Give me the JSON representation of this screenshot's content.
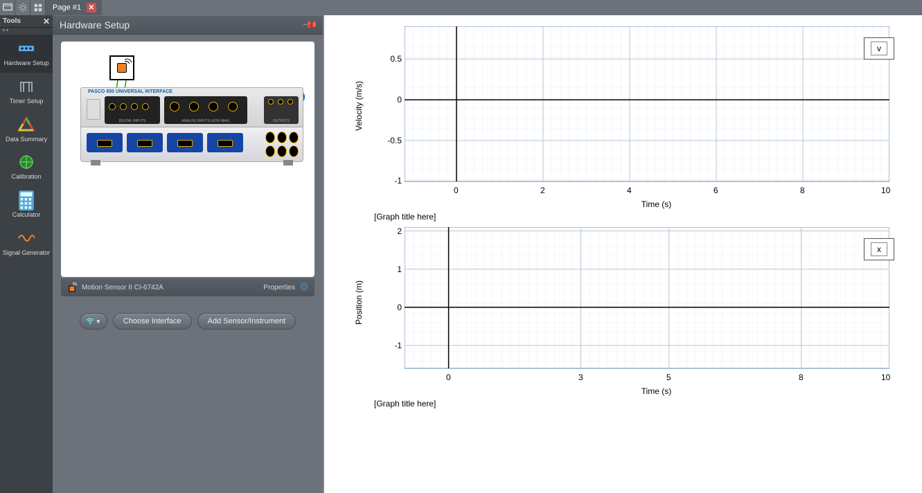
{
  "topbar": {
    "tab_label": "Page #1"
  },
  "tools_panel": {
    "header": "Tools",
    "items": [
      {
        "label": "Hardware Setup"
      },
      {
        "label": "Timer Setup"
      },
      {
        "label": "Data Summary"
      },
      {
        "label": "Calibration"
      },
      {
        "label": "Calculator"
      },
      {
        "label": "Signal Generator"
      }
    ]
  },
  "hardware_panel": {
    "title": "Hardware Setup",
    "device_title": "850 UNIVERSAL INTERFACE",
    "digital_label": "DIGITAL INPUTS",
    "analog_label": "ANALOG INPUTS (±20V MAX)",
    "output_label": "OUTPUTS",
    "sensor_name": "Motion Sensor II CI-6742A",
    "properties_label": "Properties",
    "choose_interface_label": "Choose Interface",
    "add_sensor_label": "Add Sensor/Instrument"
  },
  "chart_data": [
    {
      "type": "line",
      "ylabel": "Velocity (m/s)",
      "xlabel": "Time (s)",
      "title": "[Graph title here]",
      "legend": "v",
      "y_ticks": [
        -1.0,
        -0.5,
        0.0,
        0.5
      ],
      "x_ticks": [
        0,
        2,
        4,
        6,
        8,
        10
      ],
      "ylim": [
        -1.0,
        0.9
      ],
      "xlim": [
        -1.2,
        10
      ],
      "series": [
        {
          "name": "v",
          "values": []
        }
      ]
    },
    {
      "type": "line",
      "ylabel": "Position (m)",
      "xlabel": "Time (s)",
      "title": "[Graph title here]",
      "legend": "x",
      "y_ticks": [
        -1,
        0,
        1,
        2
      ],
      "x_ticks": [
        0,
        3,
        5,
        8,
        10
      ],
      "ylim": [
        -1.6,
        2.1
      ],
      "xlim": [
        -1.0,
        10
      ],
      "series": [
        {
          "name": "x",
          "values": []
        }
      ]
    }
  ]
}
